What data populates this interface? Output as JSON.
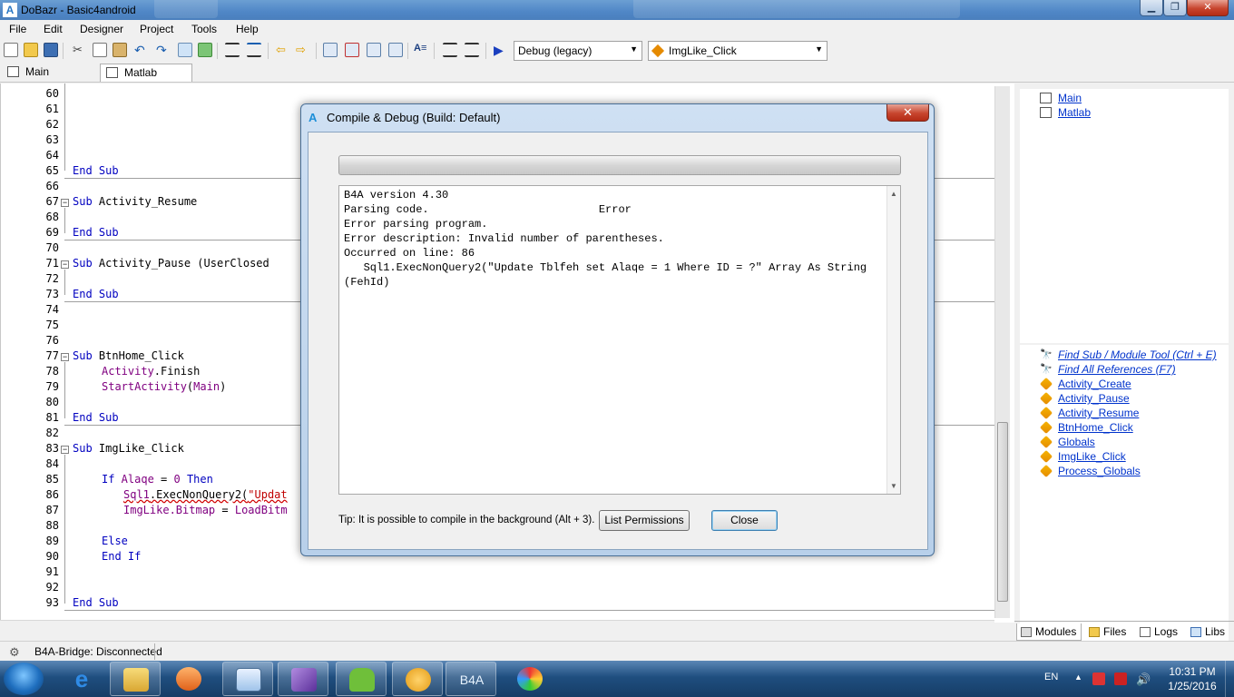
{
  "window": {
    "title": "DoBazr - Basic4android",
    "min": "▁",
    "max": "❐",
    "close": "✕",
    "app_icon_letter": "A"
  },
  "menu": {
    "items": [
      "File",
      "Edit",
      "Designer",
      "Project",
      "Tools",
      "Help"
    ]
  },
  "toolbar": {
    "build_config": "Debug (legacy)",
    "sub_selector": "ImgLike_Click",
    "icons": [
      "new-file-icon",
      "open-folder-icon",
      "save-icon",
      "cut-icon",
      "copy-icon",
      "paste-icon",
      "undo-icon",
      "redo-icon",
      "find-icon",
      "add-module-icon",
      "comment-icon",
      "uncomment-icon",
      "back-icon",
      "forward-icon",
      "bookmark-icon",
      "remove-bookmark-icon",
      "next-bookmark-icon",
      "prev-bookmark-icon",
      "font-icon",
      "indent-icon",
      "outdent-icon",
      "run-icon"
    ]
  },
  "module_tabs": [
    {
      "label": "Main"
    },
    {
      "label": "Matlab"
    }
  ],
  "editor": {
    "line_numbers": [
      "60",
      "61",
      "62",
      "63",
      "64",
      "65",
      "66",
      "67",
      "68",
      "69",
      "70",
      "71",
      "72",
      "73",
      "74",
      "75",
      "76",
      "77",
      "78",
      "79",
      "80",
      "81",
      "82",
      "83",
      "84",
      "85",
      "86",
      "87",
      "88",
      "89",
      "90",
      "91",
      "92",
      "93"
    ],
    "code": {
      "l65": "End Sub",
      "l67a": "Sub",
      "l67b": " Activity_Resume",
      "l69": "End Sub",
      "l71a": "Sub",
      "l71b": " Activity_Pause (UserClosed ",
      "l73": "End Sub",
      "l77a": "Sub",
      "l77b": " BtnHome_Click",
      "l78a": "Activity",
      "l78b": ".Finish",
      "l79a": "StartActivity",
      "l79b": "(",
      "l79c": "Main",
      "l79d": ")",
      "l81": "End Sub",
      "l83a": "Sub",
      "l83b": " ImgLike_Click",
      "l85a": "If",
      "l85b": " Alaqe",
      "l85c": " = ",
      "l85d": "0",
      "l85e": " Then",
      "l86a": "Sql1",
      "l86b": ".ExecNonQuery2(",
      "l86c": "\"Updat",
      "l87a": "ImgLike",
      "l87b": ".Bitmap",
      "l87c": " = ",
      "l87d": "LoadBitm",
      "l89": "Else",
      "l90": "End If",
      "l93": "End Sub"
    }
  },
  "right_panel": {
    "modules": [
      "Main",
      "Matlab"
    ],
    "tools": [
      "Find Sub / Module Tool (Ctrl + E)",
      "Find All References (F7)"
    ],
    "subs": [
      "Activity_Create",
      "Activity_Pause",
      "Activity_Resume",
      "BtnHome_Click",
      "Globals",
      "ImgLike_Click",
      "Process_Globals"
    ],
    "tabs": [
      "Modules",
      "Files",
      "Logs",
      "Libs"
    ]
  },
  "status_bar": {
    "bridge": "B4A-Bridge: Disconnected"
  },
  "dialog": {
    "title": "Compile & Debug (Build: Default)",
    "icon_letter": "A",
    "close": "✕",
    "output_lines": [
      "B4A version 4.30",
      "Parsing code.                          Error",
      "Error parsing program.",
      "Error description: Invalid number of parentheses.",
      "Occurred on line: 86",
      "   Sql1.ExecNonQuery2(\"Update Tblfeh set Alaqe = 1 Where ID = ?\" Array As String",
      "(FehId)"
    ],
    "tip": "Tip: It is possible to compile in the background (Alt + 3).",
    "btn_permissions": "List Permissions",
    "btn_close": "Close"
  },
  "taskbar": {
    "language": "EN",
    "time": "10:31 PM",
    "date": "1/25/2016",
    "b4a_label": "B4A"
  }
}
